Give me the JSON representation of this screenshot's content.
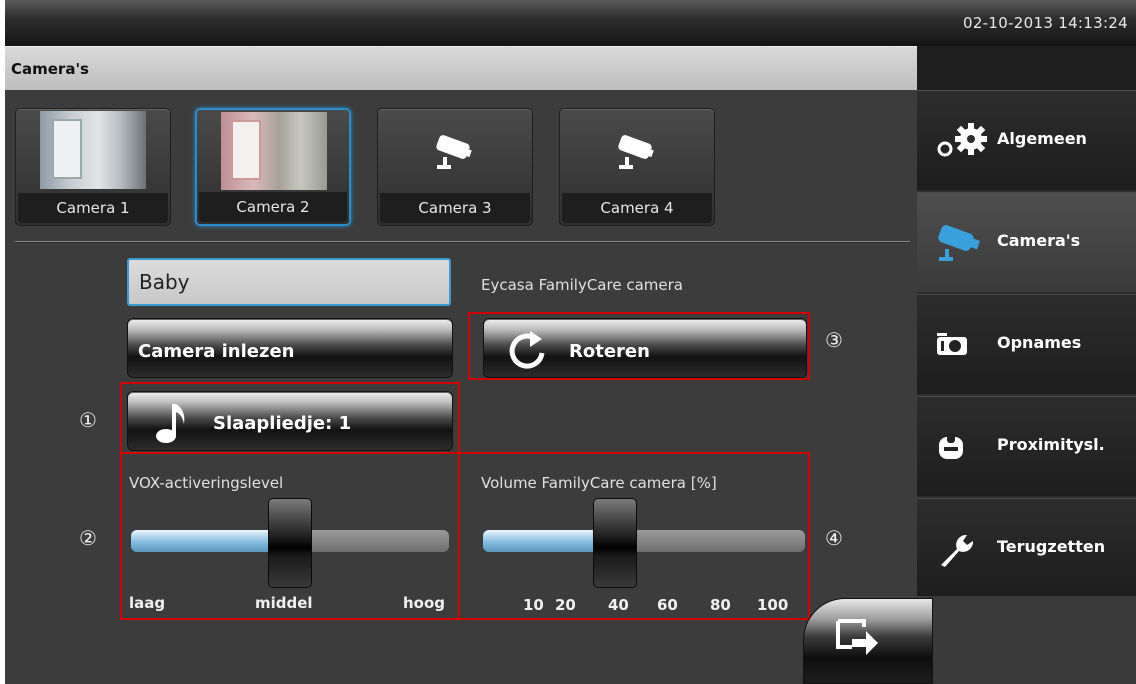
{
  "header": {
    "datetime": "02-10-2013 14:13:24"
  },
  "page": {
    "title": "Camera's"
  },
  "cameras": [
    {
      "label": "Camera 1",
      "state": "connected"
    },
    {
      "label": "Camera 2",
      "state": "selected"
    },
    {
      "label": "Camera 3",
      "state": "empty"
    },
    {
      "label": "Camera 4",
      "state": "empty"
    }
  ],
  "form": {
    "camera_name": "Baby",
    "camera_model": "Eycasa FamilyCare camera",
    "read_button": "Camera inlezen",
    "rotate_button": "Roteren",
    "lullaby_button": "Slaapliedje: 1"
  },
  "vox": {
    "label": "VOX-activeringslevel",
    "low": "laag",
    "mid": "middel",
    "high": "hoog",
    "level": 0.5
  },
  "volume": {
    "label": "Volume FamilyCare camera [%]",
    "ticks": [
      "10",
      "20",
      "40",
      "60",
      "80",
      "100"
    ],
    "value": 40
  },
  "markers": {
    "m1": "①",
    "m2": "②",
    "m3": "③",
    "m4": "④"
  },
  "sidebar": {
    "items": [
      {
        "label": "Algemeen",
        "icon": "gears-icon"
      },
      {
        "label": "Camera's",
        "icon": "camera-icon",
        "active": true
      },
      {
        "label": "Opnames",
        "icon": "recordings-icon"
      },
      {
        "label": "Proximitysl.",
        "icon": "proximity-icon"
      },
      {
        "label": "Terugzetten",
        "icon": "wrench-icon"
      }
    ]
  },
  "colors": {
    "accent": "#2a8cc8",
    "highlight": "#d40000"
  }
}
